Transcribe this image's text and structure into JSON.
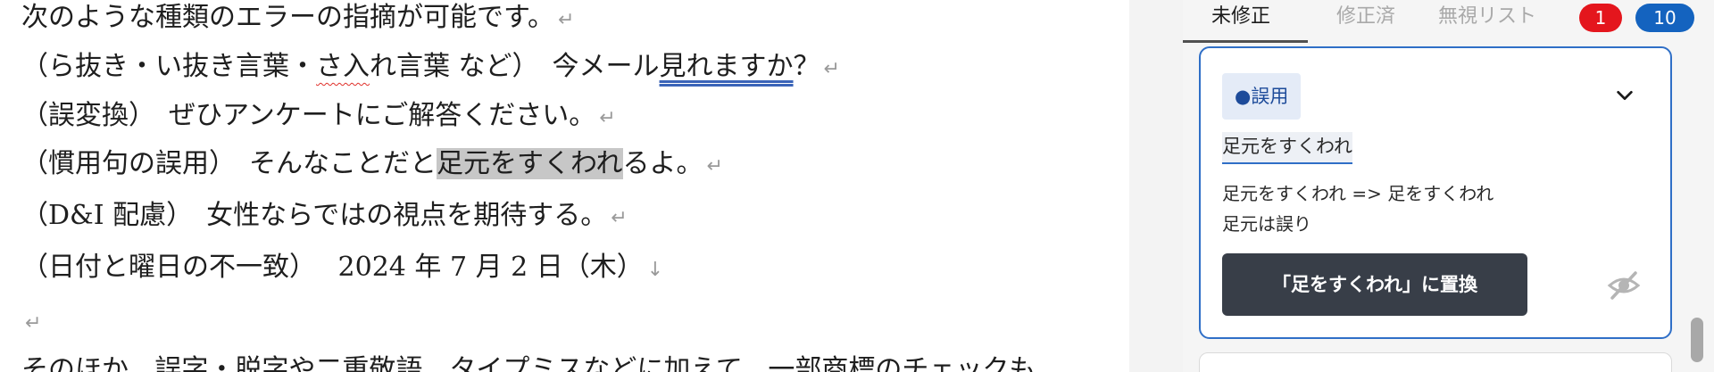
{
  "document": {
    "lines": [
      {
        "text": "次のような種類のエラーの指摘が可能です。",
        "mark": "↵"
      },
      {
        "prefix": "（ら抜き・い抜き言葉・",
        "wavy": "さ入",
        "mid": "れ言葉 など）　今メール",
        "dbl": "見れますか",
        "suffix": "？",
        "mark": "↵"
      },
      {
        "text": "（誤変換）　ぜひアンケートにご解答ください。",
        "mark": "↵"
      },
      {
        "prefix": "（慣用句の誤用）　そんなことだと",
        "hl": "足元をすくわれ",
        "suffix": "るよ。",
        "mark": "↵"
      },
      {
        "text": "（D&I 配慮）　女性ならではの視点を期待する。",
        "mark": "↵"
      },
      {
        "text": "（日付と曜日の不一致）　 2024 年 7 月 2 日（木）",
        "mark": "↓"
      },
      {
        "text": "",
        "mark": "↵"
      },
      {
        "text": "そのほか、誤字・脱字や二重敬語、タイプミスなどに加えて、一部商標のチェックも"
      }
    ]
  },
  "panel": {
    "tabs": [
      {
        "label": "未修正",
        "active": true
      },
      {
        "label": "修正済",
        "active": false
      },
      {
        "label": "無視リスト",
        "active": false
      }
    ],
    "badges": {
      "red": "1",
      "blue": "10"
    },
    "card": {
      "category": "●誤用",
      "phrase": "足元をすくわれ",
      "suggestion_line1": "足元をすくわれ => 足をすくわれ",
      "suggestion_line2": "足元は誤り",
      "replace_label": "「足をすくわれ」に置換"
    }
  },
  "colors": {
    "accent": "#2f6fc7",
    "badge_red": "#e4161d",
    "badge_blue": "#1463bf",
    "button_dark": "#383e48",
    "highlight_gray": "#c7c7c7"
  },
  "icons": [
    "chevron-down-icon",
    "eye-slash-icon"
  ]
}
